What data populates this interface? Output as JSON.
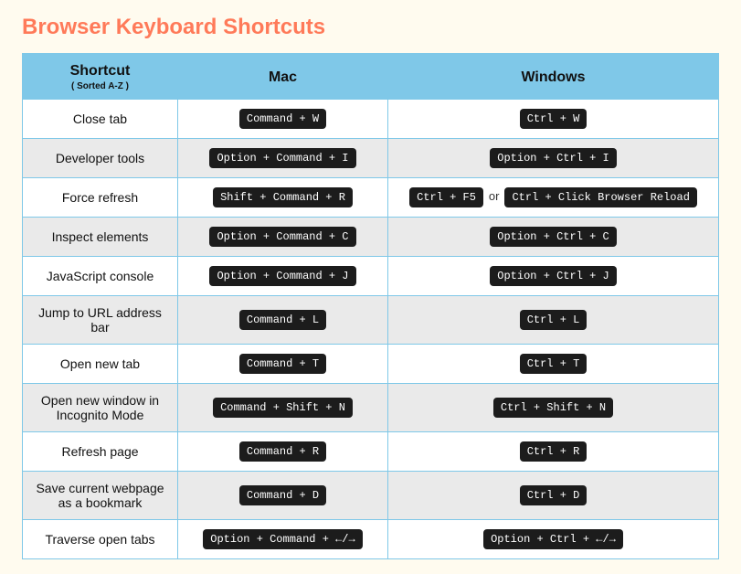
{
  "title": "Browser Keyboard Shortcuts",
  "columns": {
    "shortcut": "Shortcut",
    "shortcut_sub": "( Sorted A-Z )",
    "mac": "Mac",
    "windows": "Windows"
  },
  "or_label": "or",
  "rows": [
    {
      "name": "Close tab",
      "mac": [
        "Command + W"
      ],
      "win": [
        "Ctrl + W"
      ]
    },
    {
      "name": "Developer tools",
      "mac": [
        "Option + Command + I"
      ],
      "win": [
        "Option + Ctrl + I"
      ]
    },
    {
      "name": "Force refresh",
      "mac": [
        "Shift + Command + R"
      ],
      "win": [
        "Ctrl + F5",
        "Ctrl + Click Browser Reload"
      ]
    },
    {
      "name": "Inspect elements",
      "mac": [
        "Option + Command + C"
      ],
      "win": [
        "Option + Ctrl + C"
      ]
    },
    {
      "name": "JavaScript console",
      "mac": [
        "Option + Command + J"
      ],
      "win": [
        "Option + Ctrl + J"
      ]
    },
    {
      "name": "Jump to URL address bar",
      "mac": [
        "Command + L"
      ],
      "win": [
        "Ctrl + L"
      ]
    },
    {
      "name": "Open new tab",
      "mac": [
        "Command + T"
      ],
      "win": [
        "Ctrl + T"
      ]
    },
    {
      "name": "Open new window in Incognito Mode",
      "mac": [
        "Command + Shift + N"
      ],
      "win": [
        "Ctrl + Shift + N"
      ]
    },
    {
      "name": "Refresh page",
      "mac": [
        "Command + R"
      ],
      "win": [
        "Ctrl + R"
      ]
    },
    {
      "name": "Save current webpage as a bookmark",
      "mac": [
        "Command + D"
      ],
      "win": [
        "Ctrl + D"
      ]
    },
    {
      "name": "Traverse open tabs",
      "mac": [
        "Option + Command + ←/→"
      ],
      "win": [
        "Option + Ctrl + ←/→"
      ]
    }
  ]
}
